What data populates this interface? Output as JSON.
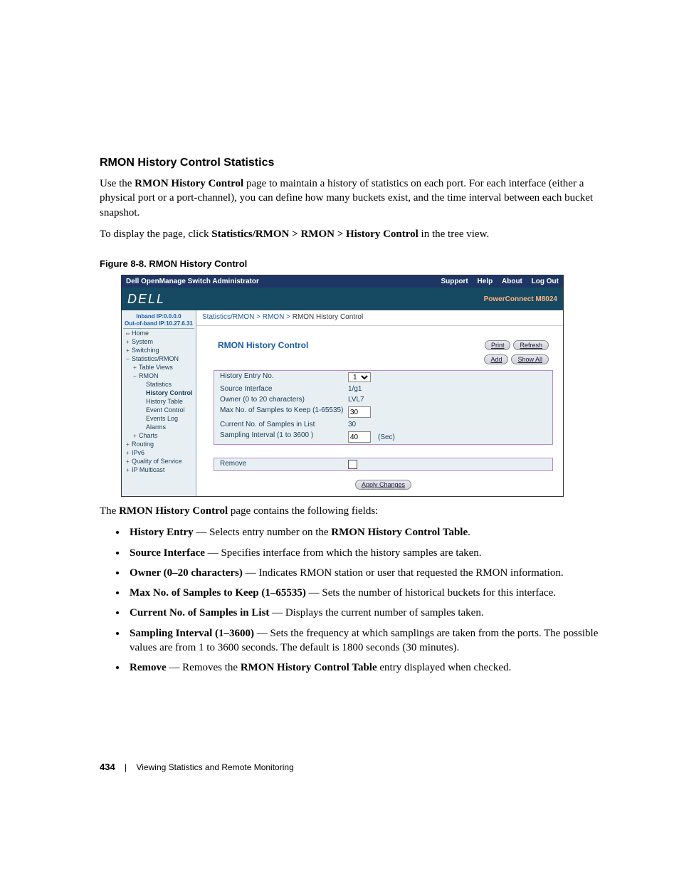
{
  "section_title": "RMON History Control Statistics",
  "para1_pre": "Use the ",
  "para1_bold": "RMON History Control",
  "para1_post": " page to maintain a history of statistics on each port. For each interface (either a physical port or a port-channel), you can define how many buckets exist, and the time interval between each bucket snapshot.",
  "para2_pre": "To display the page, click ",
  "para2_bold": "Statistics/RMON > RMON > History Control",
  "para2_post": " in the tree view.",
  "figure_caption": "Figure 8-8.    RMON History Control",
  "after_figure_pre": "The ",
  "after_figure_bold": "RMON History Control",
  "after_figure_post": " page contains the following fields:",
  "fields": [
    {
      "term": "History Entry",
      "sep": " — ",
      "desc_pre": "Selects entry number on the ",
      "desc_bold": "RMON History Control Table",
      "desc_post": "."
    },
    {
      "term": "Source Interface",
      "sep": " — ",
      "desc_pre": "Specifies interface from which the history samples are taken.",
      "desc_bold": "",
      "desc_post": ""
    },
    {
      "term": "Owner (0–20 characters)",
      "sep": " — ",
      "desc_pre": "Indicates RMON station or user that requested the RMON information.",
      "desc_bold": "",
      "desc_post": ""
    },
    {
      "term": "Max No. of Samples to Keep (1–65535)",
      "sep": " — ",
      "desc_pre": "Sets the number of historical buckets for this interface.",
      "desc_bold": "",
      "desc_post": ""
    },
    {
      "term": "Current No. of Samples in List",
      "sep": " — ",
      "desc_pre": "Displays the current number of samples taken.",
      "desc_bold": "",
      "desc_post": ""
    },
    {
      "term": "Sampling Interval (1–3600)",
      "sep": " — ",
      "desc_pre": "Sets the frequency at which samplings are taken from the ports. The possible values are from 1 to 3600 seconds. The default is 1800 seconds (30 minutes).",
      "desc_bold": "",
      "desc_post": ""
    },
    {
      "term": "Remove",
      "sep": " — ",
      "desc_pre": "Removes the ",
      "desc_bold": "RMON History Control Table",
      "desc_post": " entry displayed when checked."
    }
  ],
  "footer_page": "434",
  "footer_sep": "|",
  "footer_chapter": "Viewing Statistics and Remote Monitoring",
  "screenshot": {
    "topbar_title": "Dell OpenManage Switch Administrator",
    "topbar_links": [
      "Support",
      "Help",
      "About",
      "Log Out"
    ],
    "banner_logo": "DELL",
    "banner_model": "PowerConnect M8024",
    "ip_inband": "Inband IP:0.0.0.0",
    "ip_oob": "Out-of-band IP:10.27.6.31",
    "tree": [
      {
        "lvl": 1,
        "glyph": "▭",
        "label": "Home"
      },
      {
        "lvl": 1,
        "glyph": "+",
        "label": "System"
      },
      {
        "lvl": 1,
        "glyph": "+",
        "label": "Switching"
      },
      {
        "lvl": 1,
        "glyph": "−",
        "label": "Statistics/RMON"
      },
      {
        "lvl": 2,
        "glyph": "+",
        "label": "Table Views"
      },
      {
        "lvl": 2,
        "glyph": "−",
        "label": "RMON"
      },
      {
        "lvl": 3,
        "glyph": "",
        "label": "Statistics"
      },
      {
        "lvl": 3,
        "glyph": "",
        "label": "History Control",
        "selected": true
      },
      {
        "lvl": 3,
        "glyph": "",
        "label": "History Table"
      },
      {
        "lvl": 3,
        "glyph": "",
        "label": "Event Control"
      },
      {
        "lvl": 3,
        "glyph": "",
        "label": "Events Log"
      },
      {
        "lvl": 3,
        "glyph": "",
        "label": "Alarms"
      },
      {
        "lvl": 2,
        "glyph": "+",
        "label": "Charts"
      },
      {
        "lvl": 1,
        "glyph": "+",
        "label": "Routing"
      },
      {
        "lvl": 1,
        "glyph": "+",
        "label": "IPv6"
      },
      {
        "lvl": 1,
        "glyph": "+",
        "label": "Quality of Service"
      },
      {
        "lvl": 1,
        "glyph": "+",
        "label": "IP Multicast"
      }
    ],
    "breadcrumb": {
      "a": "Statistics/RMON",
      "b": "RMON",
      "c": "RMON History Control"
    },
    "panel_title": "RMON History Control",
    "buttons_row1": [
      "Print",
      "Refresh"
    ],
    "buttons_row2": [
      "Add",
      "Show All"
    ],
    "form": [
      {
        "label": "History Entry No.",
        "value": "1",
        "type": "select"
      },
      {
        "label": "Source Interface",
        "value": "1/g1",
        "type": "text"
      },
      {
        "label": "Owner (0 to 20 characters)",
        "value": "LVL7",
        "type": "text"
      },
      {
        "label": "Max No. of Samples to Keep (1-65535)",
        "value": "30",
        "type": "num"
      },
      {
        "label": "Current No. of Samples in List",
        "value": "30",
        "type": "text"
      },
      {
        "label": "Sampling Interval (1 to 3600 )",
        "value": "40",
        "suffix": "(Sec)",
        "type": "num"
      }
    ],
    "form2_label": "Remove",
    "apply_button": "Apply Changes"
  }
}
